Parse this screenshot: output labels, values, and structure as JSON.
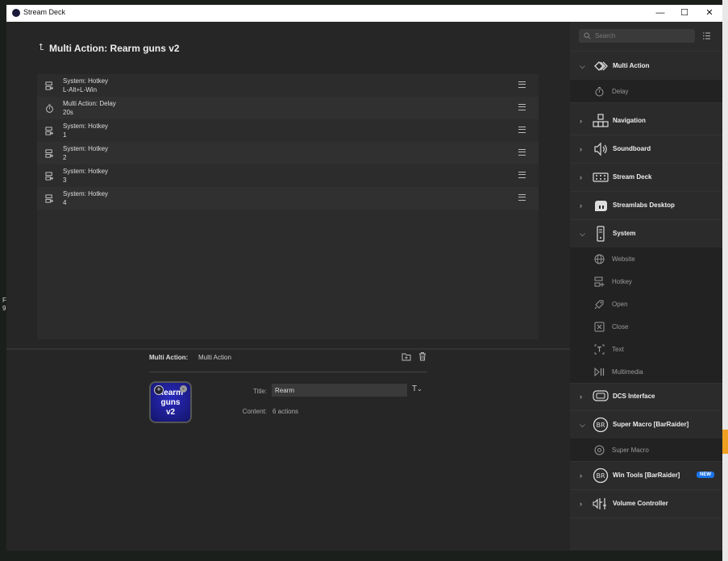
{
  "window": {
    "title": "Stream Deck",
    "controls": {
      "minimize": "—",
      "maximize": "☐",
      "close": "✕"
    }
  },
  "editor": {
    "heading": "Multi Action: Rearm guns v2",
    "actions": [
      {
        "line1": "System: Hotkey",
        "line2": "L-Alt+L-Win",
        "icon": "hotkey-icon"
      },
      {
        "line1": "Multi Action: Delay",
        "line2": "20s",
        "icon": "timer-icon"
      },
      {
        "line1": "System: Hotkey",
        "line2": "1",
        "icon": "hotkey-icon"
      },
      {
        "line1": "System: Hotkey",
        "line2": "2",
        "icon": "hotkey-icon"
      },
      {
        "line1": "System: Hotkey",
        "line2": "3",
        "icon": "hotkey-icon"
      },
      {
        "line1": "System: Hotkey",
        "line2": "4",
        "icon": "hotkey-icon"
      }
    ]
  },
  "properties": {
    "label": "Multi Action:",
    "value": "Multi Action",
    "key_text": "Rearm\nguns\nv2",
    "key_plus": "+",
    "key_chevron": "⌄",
    "title_label": "Title:",
    "title_value": "Rearm",
    "font_button": "T",
    "font_chevron": "⌄",
    "content_label": "Content:",
    "content_value": "6 actions",
    "colors": {
      "key_bg": "#1c1cae",
      "panel_bg": "#262626"
    }
  },
  "sidebar": {
    "search_placeholder": "Search",
    "categories": [
      {
        "label": "Multi Action",
        "expanded": true,
        "icon": "multi-action-icon",
        "children": [
          {
            "label": "Delay",
            "icon": "timer-icon"
          }
        ]
      },
      {
        "label": "Navigation",
        "expanded": false,
        "icon": "navigation-icon"
      },
      {
        "label": "Soundboard",
        "expanded": false,
        "icon": "speaker-icon"
      },
      {
        "label": "Stream Deck",
        "expanded": false,
        "icon": "stream-deck-icon"
      },
      {
        "label": "Streamlabs Desktop",
        "expanded": false,
        "icon": "streamlabs-icon"
      },
      {
        "label": "System",
        "expanded": true,
        "icon": "system-icon",
        "children": [
          {
            "label": "Website",
            "icon": "globe-icon"
          },
          {
            "label": "Hotkey",
            "icon": "hotkey-icon"
          },
          {
            "label": "Open",
            "icon": "rocket-icon"
          },
          {
            "label": "Close",
            "icon": "close-box-icon"
          },
          {
            "label": "Text",
            "icon": "text-icon"
          },
          {
            "label": "Multimedia",
            "icon": "play-pause-icon"
          }
        ]
      },
      {
        "label": "DCS Interface",
        "expanded": false,
        "icon": "dcs-icon"
      },
      {
        "label": "Super Macro [BarRaider]",
        "expanded": true,
        "icon": "barraider-icon",
        "children": [
          {
            "label": "Super Macro",
            "icon": "macro-icon"
          }
        ]
      },
      {
        "label": "Win Tools [BarRaider]",
        "expanded": false,
        "icon": "barraider-icon",
        "badge": "NEW"
      },
      {
        "label": "Volume Controller",
        "expanded": false,
        "icon": "volume-icon"
      }
    ]
  },
  "desktop": {
    "partial_text": "F\n9"
  }
}
